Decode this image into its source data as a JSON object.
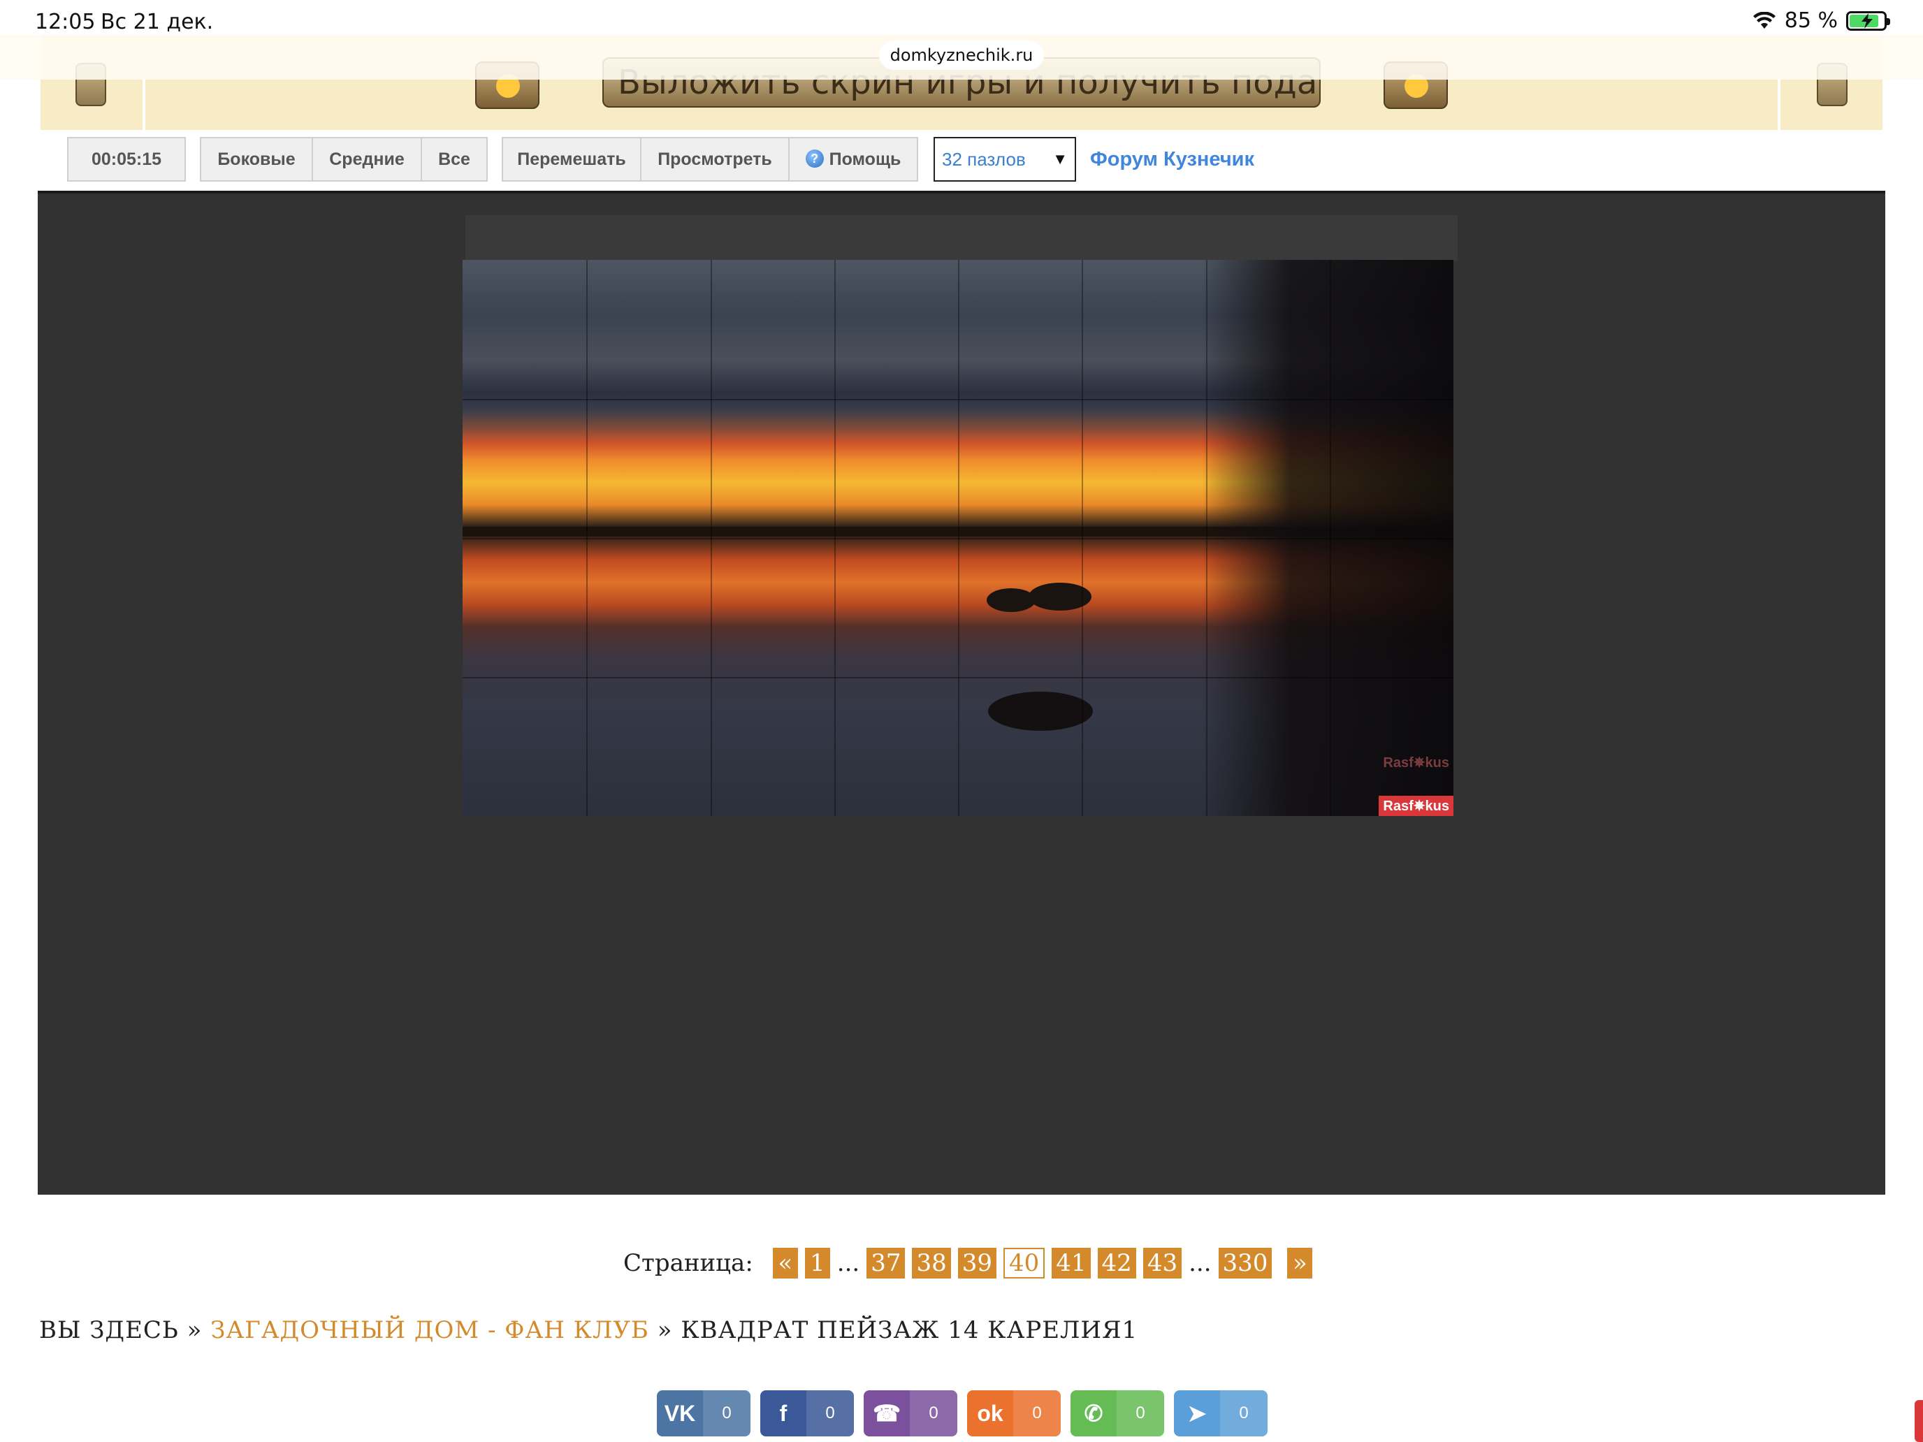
{
  "status_bar": {
    "time": "12:05",
    "date": "Вс 21 дек.",
    "battery": "85 %",
    "battery_level": 0.85
  },
  "browser": {
    "url": "domkyznechik.ru"
  },
  "banner": {
    "cta": "Выложить скрин игры и получить подарок"
  },
  "toolbar": {
    "timer": "00:05:15",
    "filter_side": "Боковые",
    "filter_middle": "Средние",
    "filter_all": "Все",
    "shuffle": "Перемешать",
    "preview": "Просмотреть",
    "help": "Помощь",
    "pieces_select": "32 пазлов",
    "forum_link": "Форум Кузнечик"
  },
  "puzzle": {
    "columns": 8,
    "rows": 4,
    "watermark": "Rasf✵kus",
    "watermark_ghost": "Rasf✵kus"
  },
  "pagination": {
    "label": "Страница:",
    "prev": "«",
    "next": "»",
    "dots": "...",
    "pages": [
      "1",
      "37",
      "38",
      "39",
      "40",
      "41",
      "42",
      "43",
      "330"
    ],
    "current": "40"
  },
  "breadcrumb": {
    "prefix": "ВЫ ЗДЕСЬ",
    "sep": "»",
    "link": "ЗАГАДОЧНЫЙ ДОМ - ФАН КЛУБ",
    "current": "КВАДРАТ ПЕЙЗАЖ 14 КАРЕЛИЯ1"
  },
  "share": [
    {
      "network": "vk",
      "icon": "vk-icon",
      "glyph": "VK",
      "count": "0",
      "color": "#4c75a3"
    },
    {
      "network": "facebook",
      "icon": "facebook-icon",
      "glyph": "f",
      "count": "0",
      "color": "#3b5998"
    },
    {
      "network": "viber",
      "icon": "viber-icon",
      "glyph": "☎",
      "count": "0",
      "color": "#7b519d"
    },
    {
      "network": "odnoklassniki",
      "icon": "odnoklassniki-icon",
      "glyph": "ok",
      "count": "0",
      "color": "#eb722e"
    },
    {
      "network": "whatsapp",
      "icon": "whatsapp-icon",
      "glyph": "✆",
      "count": "0",
      "color": "#65bc54"
    },
    {
      "network": "telegram",
      "icon": "telegram-icon",
      "glyph": "➤",
      "count": "0",
      "color": "#5b9fd8"
    }
  ]
}
